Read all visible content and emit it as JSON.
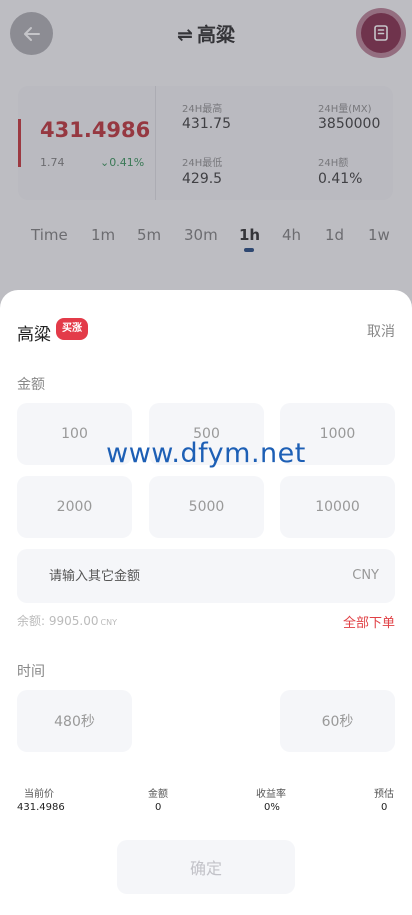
{
  "header": {
    "title": "高粱",
    "swap_symbol": "⇌",
    "back_icon": "back-arrow-icon",
    "order_icon": "order-book-icon"
  },
  "price_card": {
    "price": "431.4986",
    "change_abs": "1.74",
    "change_pct": "0.41%",
    "stats": {
      "high_label": "24H最高",
      "high_value": "431.75",
      "volume_label": "24H量(MX)",
      "volume_value": "3850000",
      "low_label": "24H最低",
      "low_value": "429.5",
      "amount_label": "24H额",
      "amount_value": "0.41%"
    }
  },
  "timeframes": [
    "Time",
    "1m",
    "5m",
    "30m",
    "1h",
    "4h",
    "1d",
    "1w"
  ],
  "active_timeframe": "1h",
  "sheet": {
    "title": "高粱",
    "badge": "买涨",
    "cancel": "取消",
    "amount_label": "金额",
    "amounts": [
      "100",
      "500",
      "1000",
      "2000",
      "5000",
      "10000"
    ],
    "custom_placeholder": "请输入其它金额",
    "currency": "CNY",
    "balance_label": "余额:",
    "balance_value": "9905.00",
    "balance_unit": "CNY",
    "all_order": "全部下单",
    "time_label": "时间",
    "times": [
      "480秒",
      "60秒"
    ],
    "summary": {
      "price_label": "当前价",
      "price_value": "431.4986",
      "amount_label": "金额",
      "amount_value": "0",
      "rate_label": "收益率",
      "rate_value": "0%",
      "estimate_label": "预估",
      "estimate_value": "0"
    },
    "confirm": "确定"
  },
  "watermark": "www.dfym.net",
  "colors": {
    "rise_red": "#b7272e",
    "badge_red": "#e33b49",
    "green": "#2c8b50",
    "accent_navy": "#1a3f78",
    "watermark_blue": "#1d5fb5"
  }
}
